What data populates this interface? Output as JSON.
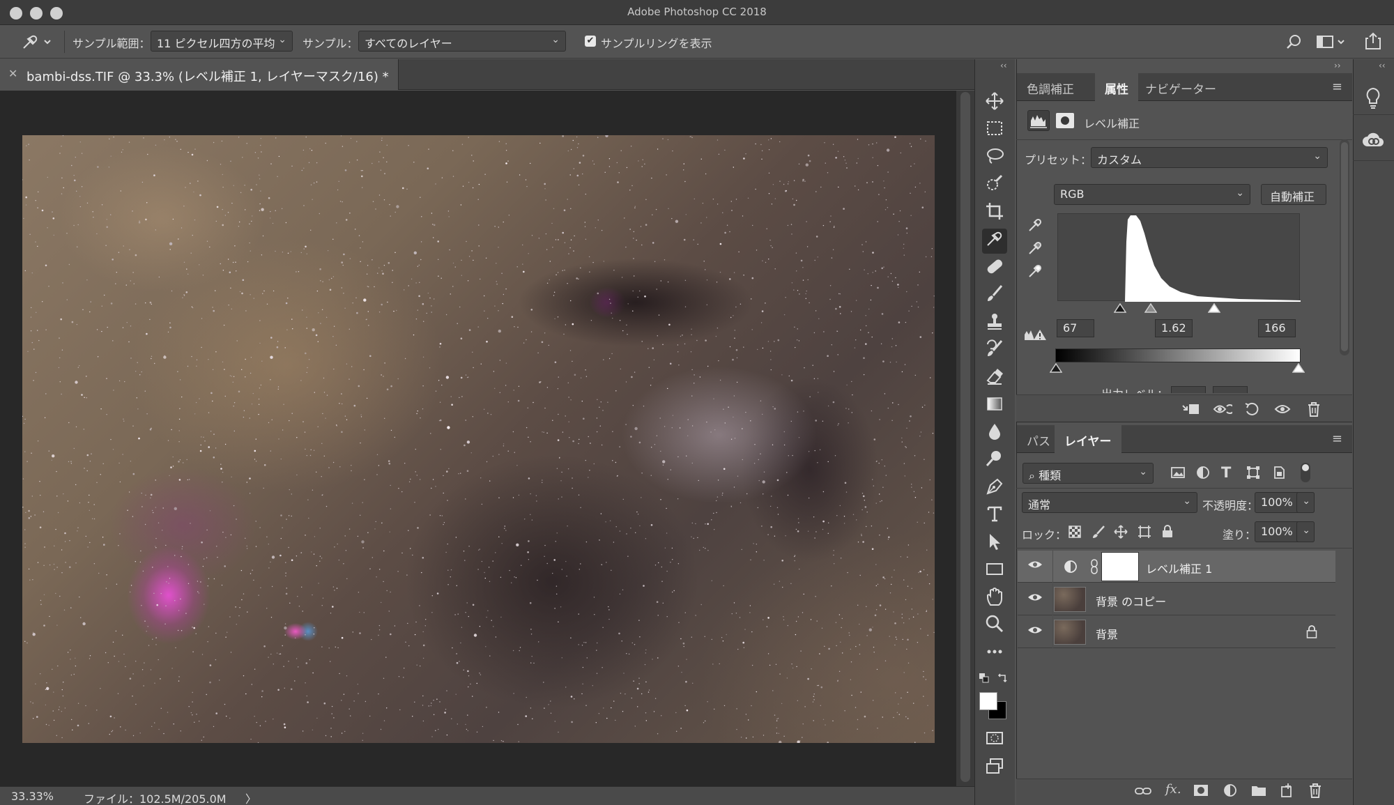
{
  "window": {
    "title": "Adobe Photoshop CC 2018"
  },
  "options_bar": {
    "sample_size_label": "サンプル範囲：",
    "sample_size_value": "11 ピクセル四方の平均",
    "sample_label": "サンプル：",
    "sample_value": "すべてのレイヤー",
    "show_ring_label": "サンプルリングを表示",
    "show_ring_checked": true
  },
  "document": {
    "tab_title": "bambi-dss.TIF @ 33.3% (レベル補正 1, レイヤーマスク/16) *"
  },
  "status": {
    "zoom": "33.33%",
    "file_info": "ファイル：102.5M/205.0M",
    "arrow": "〉"
  },
  "tools": [
    "move-tool",
    "marquee-tool",
    "lasso-tool",
    "quick-select-tool",
    "crop-tool",
    "eyedropper-tool",
    "healing-tool",
    "brush-tool",
    "stamp-tool",
    "history-brush-tool",
    "eraser-tool",
    "gradient-tool",
    "blur-tool",
    "dodge-tool",
    "pen-tool",
    "type-tool",
    "path-select-tool",
    "shape-tool",
    "hand-tool",
    "zoom-tool",
    "more-tools"
  ],
  "properties_panel": {
    "tabs": [
      "色調補正",
      "属性",
      "ナビゲーター"
    ],
    "active_tab": "属性",
    "adjustment_name": "レベル補正",
    "preset_label": "プリセット：",
    "preset_value": "カスタム",
    "channel_value": "RGB",
    "auto_button": "自動補正",
    "input_black": "67",
    "input_gamma": "1.62",
    "input_white": "166",
    "output_label": "出力レベル："
  },
  "layers_panel": {
    "tabs": [
      "パス",
      "レイヤー"
    ],
    "active_tab": "レイヤー",
    "filter_value": "種類",
    "blend_mode": "通常",
    "opacity_label": "不透明度：",
    "opacity_value": "100%",
    "lock_label": "ロック：",
    "fill_label": "塗り：",
    "fill_value": "100%",
    "layers": [
      {
        "name": "レベル補正 1",
        "type": "adjustment",
        "visible": true,
        "selected": true,
        "locked": false
      },
      {
        "name": "背景 のコピー",
        "type": "pixel",
        "visible": true,
        "selected": false,
        "locked": false
      },
      {
        "name": "背景",
        "type": "pixel",
        "visible": true,
        "selected": false,
        "locked": true
      }
    ]
  }
}
